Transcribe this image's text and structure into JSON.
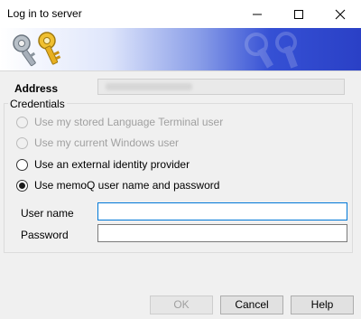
{
  "window": {
    "title": "Log in to server"
  },
  "address": {
    "label": "Address"
  },
  "credentials": {
    "group_label": "Credentials",
    "options": [
      {
        "label": "Use my stored Language Terminal user",
        "enabled": false,
        "checked": false
      },
      {
        "label": "Use my current Windows user",
        "enabled": false,
        "checked": false
      },
      {
        "label": "Use an external identity provider",
        "enabled": true,
        "checked": false
      },
      {
        "label": "Use memoQ user name and password",
        "enabled": true,
        "checked": true
      }
    ],
    "username_label": "User name",
    "username_value": "",
    "password_label": "Password",
    "password_value": ""
  },
  "buttons": {
    "ok_label": "OK",
    "cancel_label": "Cancel",
    "help_label": "Help"
  },
  "icons": {
    "banner": "keys-icon",
    "minimize": "minimize-icon",
    "maximize": "maximize-icon",
    "close": "close-icon"
  },
  "colors": {
    "banner_accent": "#2a40c6",
    "focus_border": "#0078d7"
  }
}
